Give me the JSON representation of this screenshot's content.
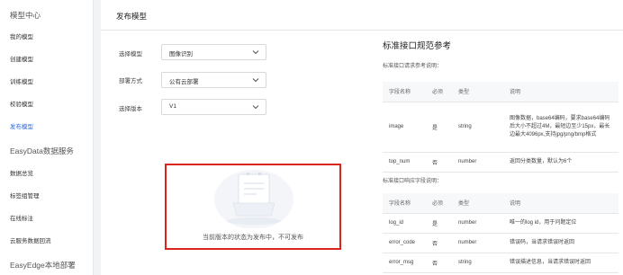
{
  "sidebar": {
    "items": [
      {
        "label": "模型中心",
        "type": "section"
      },
      {
        "label": "我的模型",
        "type": "item"
      },
      {
        "label": "创建模型",
        "type": "item"
      },
      {
        "label": "训练模型",
        "type": "item"
      },
      {
        "label": "校验模型",
        "type": "item"
      },
      {
        "label": "发布模型",
        "type": "active"
      },
      {
        "label": "EasyData数据服务",
        "type": "section"
      },
      {
        "label": "数据总览",
        "type": "item"
      },
      {
        "label": "标签组管理",
        "type": "item"
      },
      {
        "label": "在线标注",
        "type": "item"
      },
      {
        "label": "云服务数据回流",
        "type": "item"
      },
      {
        "label": "EasyEdge本地部署",
        "type": "section"
      }
    ]
  },
  "main": {
    "title": "发布模型",
    "form": {
      "model_label": "选择模型",
      "model_value": "图像识别",
      "deploy_label": "部署方式",
      "deploy_value": "公有云部署",
      "version_label": "选择版本",
      "version_value": "V1"
    },
    "empty_state": {
      "message": "当前版本的状态为发布中，不可发布"
    }
  },
  "reference": {
    "title": "标准接口规范参考",
    "request_subtitle": "标准接口请求参考说明：",
    "response_subtitle": "标准接口响应字段说明：",
    "request_table": {
      "headers": [
        "字段名称",
        "必须",
        "类型",
        "说明"
      ],
      "rows": [
        [
          "image",
          "是",
          "string",
          "图像数据，base64编码，要求base64编码后大小不超过4M，最短边至少15px，最长边最大4096px,支持jpg/png/bmp格式"
        ],
        [
          "top_num",
          "否",
          "number",
          "返回分类数量，默认为6个"
        ]
      ]
    },
    "response_table": {
      "headers": [
        "字段名称",
        "必须",
        "类型",
        "说明"
      ],
      "rows": [
        [
          "log_id",
          "是",
          "number",
          "唯一的log id，用于问题定位"
        ],
        [
          "error_code",
          "否",
          "number",
          "错误码，当请求错误时返回"
        ],
        [
          "error_msg",
          "否",
          "string",
          "错误描述信息，当请求错误时返回"
        ]
      ]
    }
  },
  "colors": {
    "accent": "#2468f2",
    "highlight_border": "#d9251c"
  }
}
